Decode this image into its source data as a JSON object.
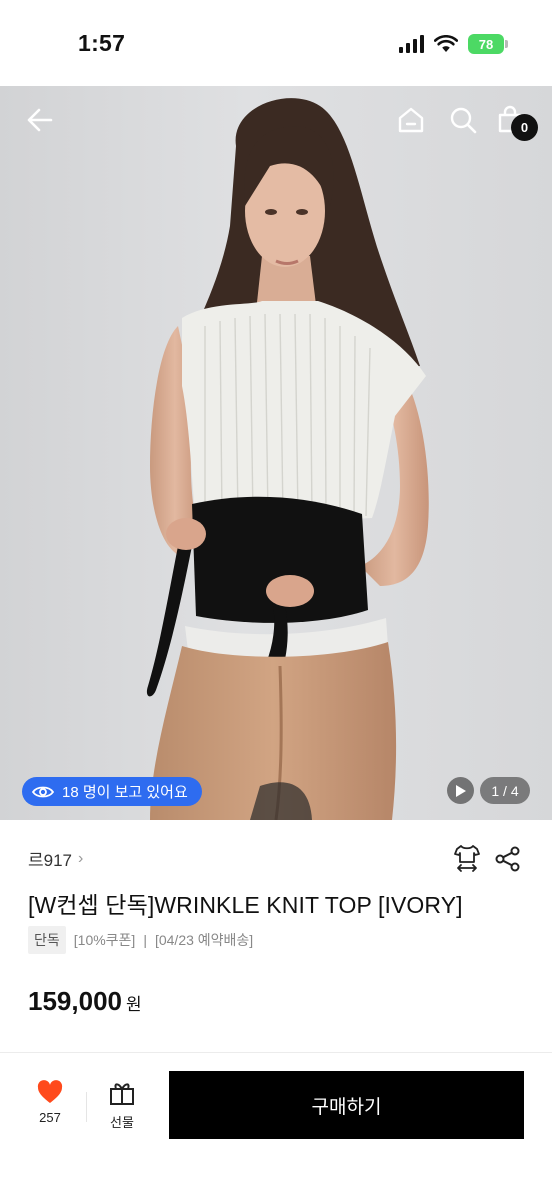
{
  "status_bar": {
    "time": "1:57",
    "battery": "78"
  },
  "nav": {
    "cart_count": "0"
  },
  "hero": {
    "viewers_text": "18 명이 보고 있어요",
    "page_indicator": "1 / 4"
  },
  "product": {
    "brand": "르917",
    "title": "[W컨셉 단독]WRINKLE KNIT TOP [IVORY]",
    "tag_exclusive": "단독",
    "tag_coupon": "[10%쿠폰]",
    "tag_separator": "|",
    "tag_shipping": "[04/23 예약배송]",
    "price": "159,000",
    "price_unit": "원"
  },
  "bottom_bar": {
    "like_count": "257",
    "gift_label": "선물",
    "buy_label": "구매하기"
  },
  "colors": {
    "accent_blue": "#2e6cf0",
    "heart": "#ff4a1c",
    "buy_bg": "#000000"
  }
}
